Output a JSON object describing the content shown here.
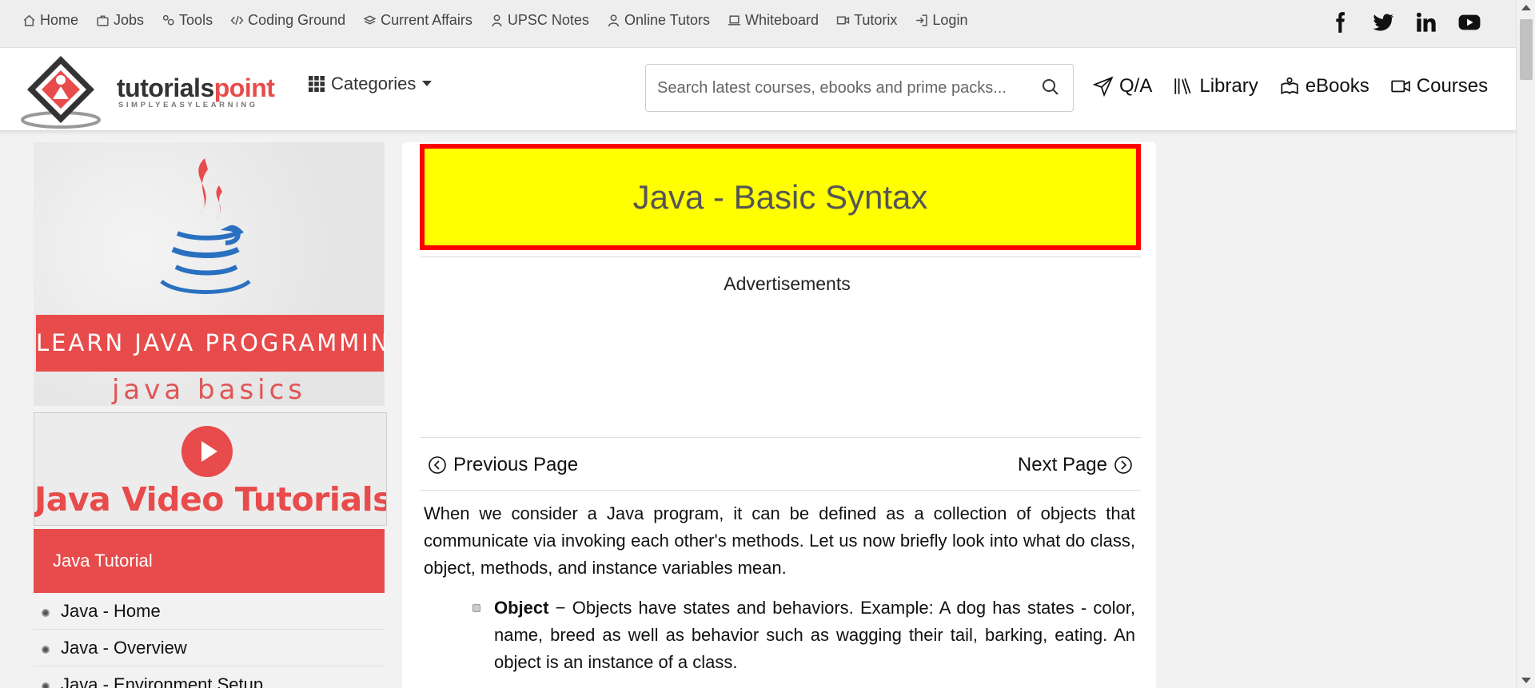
{
  "topbar": {
    "links": [
      {
        "label": "Home",
        "icon": "home-icon"
      },
      {
        "label": "Jobs",
        "icon": "briefcase-icon"
      },
      {
        "label": "Tools",
        "icon": "gears-icon"
      },
      {
        "label": "Coding Ground",
        "icon": "code-icon"
      },
      {
        "label": "Current Affairs",
        "icon": "layers-icon"
      },
      {
        "label": "UPSC Notes",
        "icon": "person-badge-icon"
      },
      {
        "label": "Online Tutors",
        "icon": "person-icon"
      },
      {
        "label": "Whiteboard",
        "icon": "laptop-icon"
      },
      {
        "label": "Tutorix",
        "icon": "camera-icon"
      },
      {
        "label": "Login",
        "icon": "login-icon"
      }
    ],
    "social": [
      "facebook-icon",
      "twitter-icon",
      "linkedin-icon",
      "youtube-icon"
    ]
  },
  "header": {
    "logo_part1": "tutorials",
    "logo_part2": "point",
    "logo_tagline": "SIMPLYEASYLEARNING",
    "categories_label": "Categories",
    "search_placeholder": "Search latest courses, ebooks and prime packs...",
    "nav": [
      {
        "label": "Q/A",
        "icon": "send-icon"
      },
      {
        "label": "Library",
        "icon": "library-icon"
      },
      {
        "label": "eBooks",
        "icon": "ebook-icon"
      },
      {
        "label": "Courses",
        "icon": "video-icon"
      }
    ]
  },
  "sidebar": {
    "banner_title": "LEARN JAVA PROGRAMMING",
    "banner_sub": "java basics",
    "video_label": "Java Video Tutorials",
    "tutorial_heading": "Java Tutorial",
    "items": [
      "Java - Home",
      "Java - Overview",
      "Java - Environment Setup"
    ]
  },
  "main": {
    "title": "Java - Basic Syntax",
    "ads_label": "Advertisements",
    "prev_label": "Previous Page",
    "next_label": "Next Page",
    "intro": "When we consider a Java program, it can be defined as a collection of objects that communicate via invoking each other's methods. Let us now briefly look into what do class, object, methods, and instance variables mean.",
    "bullets": [
      {
        "term": "Object",
        "text": " − Objects have states and behaviors. Example: A dog has states - color, name, breed as well as behavior such as wagging their tail, barking, eating. An object is an instance of a class."
      }
    ]
  },
  "colors": {
    "brand_red": "#e84b4b",
    "title_bg": "#ffff00",
    "title_border": "#ff0000"
  }
}
